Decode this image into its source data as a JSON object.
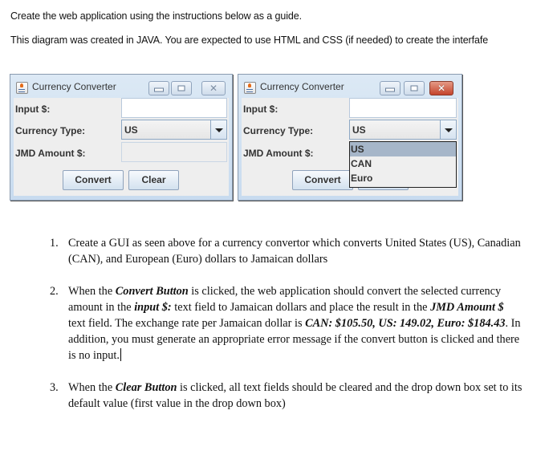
{
  "intro": {
    "line1": "Create the web application using the instructions below as a guide.",
    "line2": "This diagram was created in JAVA. You are expected to use HTML and CSS (if needed) to create the interfafe"
  },
  "windows": [
    {
      "title": "Currency Converter",
      "labels": {
        "input": "Input $:",
        "currency": "Currency Type:",
        "jmd": "JMD Amount $:"
      },
      "input_value": "",
      "currency_selected": "US",
      "jmd_value": "",
      "buttons": {
        "convert": "Convert",
        "clear": "Clear"
      },
      "close_active": false,
      "dropdown_open": false
    },
    {
      "title": "Currency Converter",
      "labels": {
        "input": "Input $:",
        "currency": "Currency Type:",
        "jmd": "JMD Amount $:"
      },
      "input_value": "",
      "currency_selected": "US",
      "jmd_value": "",
      "buttons": {
        "convert": "Convert",
        "clear": "Clear"
      },
      "close_active": true,
      "dropdown_open": true,
      "dropdown_options": [
        "US",
        "CAN",
        "Euro"
      ],
      "dropdown_highlighted": "US"
    }
  ],
  "instructions": [
    {
      "num": "1.",
      "parts": [
        {
          "t": "Create a GUI as seen above for a currency convertor which converts United States (US), Canadian (CAN), and European (Euro) dollars to Jamaican dollars",
          "b": false
        }
      ]
    },
    {
      "num": "2.",
      "parts": [
        {
          "t": "When the ",
          "b": false
        },
        {
          "t": "Convert Button",
          "b": true
        },
        {
          "t": " is clicked, the web application should convert the selected currency amount in the ",
          "b": false
        },
        {
          "t": "input $:",
          "b": true
        },
        {
          "t": " text field to Jamaican dollars and place the result in the ",
          "b": false
        },
        {
          "t": "JMD Amount $",
          "b": true
        },
        {
          "t": " text field. The exchange rate per Jamaican dollar is ",
          "b": false
        },
        {
          "t": "CAN:  $105.50, US: 149.02, Euro: $184.43",
          "b": true
        },
        {
          "t": ". In addition, you must generate an appropriate error message if the convert button is clicked and there is no input.",
          "b": false
        }
      ],
      "caret": true
    },
    {
      "num": "3.",
      "parts": [
        {
          "t": "When the ",
          "b": false
        },
        {
          "t": "Clear Button",
          "b": true
        },
        {
          "t": " is clicked, all text fields should be cleared and the drop down box set to its default value (first value in the drop down box)",
          "b": false
        }
      ]
    }
  ]
}
